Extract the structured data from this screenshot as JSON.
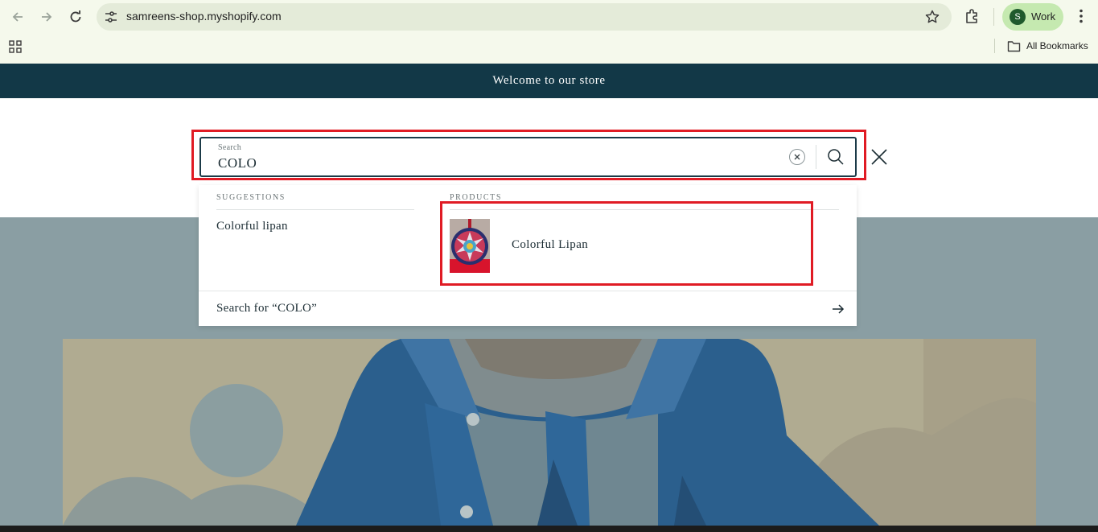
{
  "browser": {
    "url": "samreens-shop.myshopify.com",
    "profile_initial": "S",
    "profile_name": "Work",
    "bookmarks_label": "All Bookmarks"
  },
  "store": {
    "announcement": "Welcome to our store"
  },
  "search": {
    "label": "Search",
    "value": "COLO",
    "suggestions_heading": "SUGGESTIONS",
    "suggestions": [
      "Colorful lipan"
    ],
    "products_heading": "PRODUCTS",
    "products": [
      {
        "title": "Colorful Lipan",
        "thumbnail": "embroidered-round-cushion"
      }
    ],
    "search_for_text": "Search for “COLO”"
  },
  "colors": {
    "announcement_bg": "#123847",
    "highlight": "#e01b24",
    "hero_bg": "#8a9ea3"
  },
  "icons": [
    "back-icon",
    "forward-icon",
    "reload-icon",
    "tune-icon",
    "star-icon",
    "extensions-icon",
    "menu-icon",
    "apps-icon",
    "folder-icon",
    "clear-icon",
    "search-icon",
    "close-icon",
    "arrow-right-icon"
  ]
}
